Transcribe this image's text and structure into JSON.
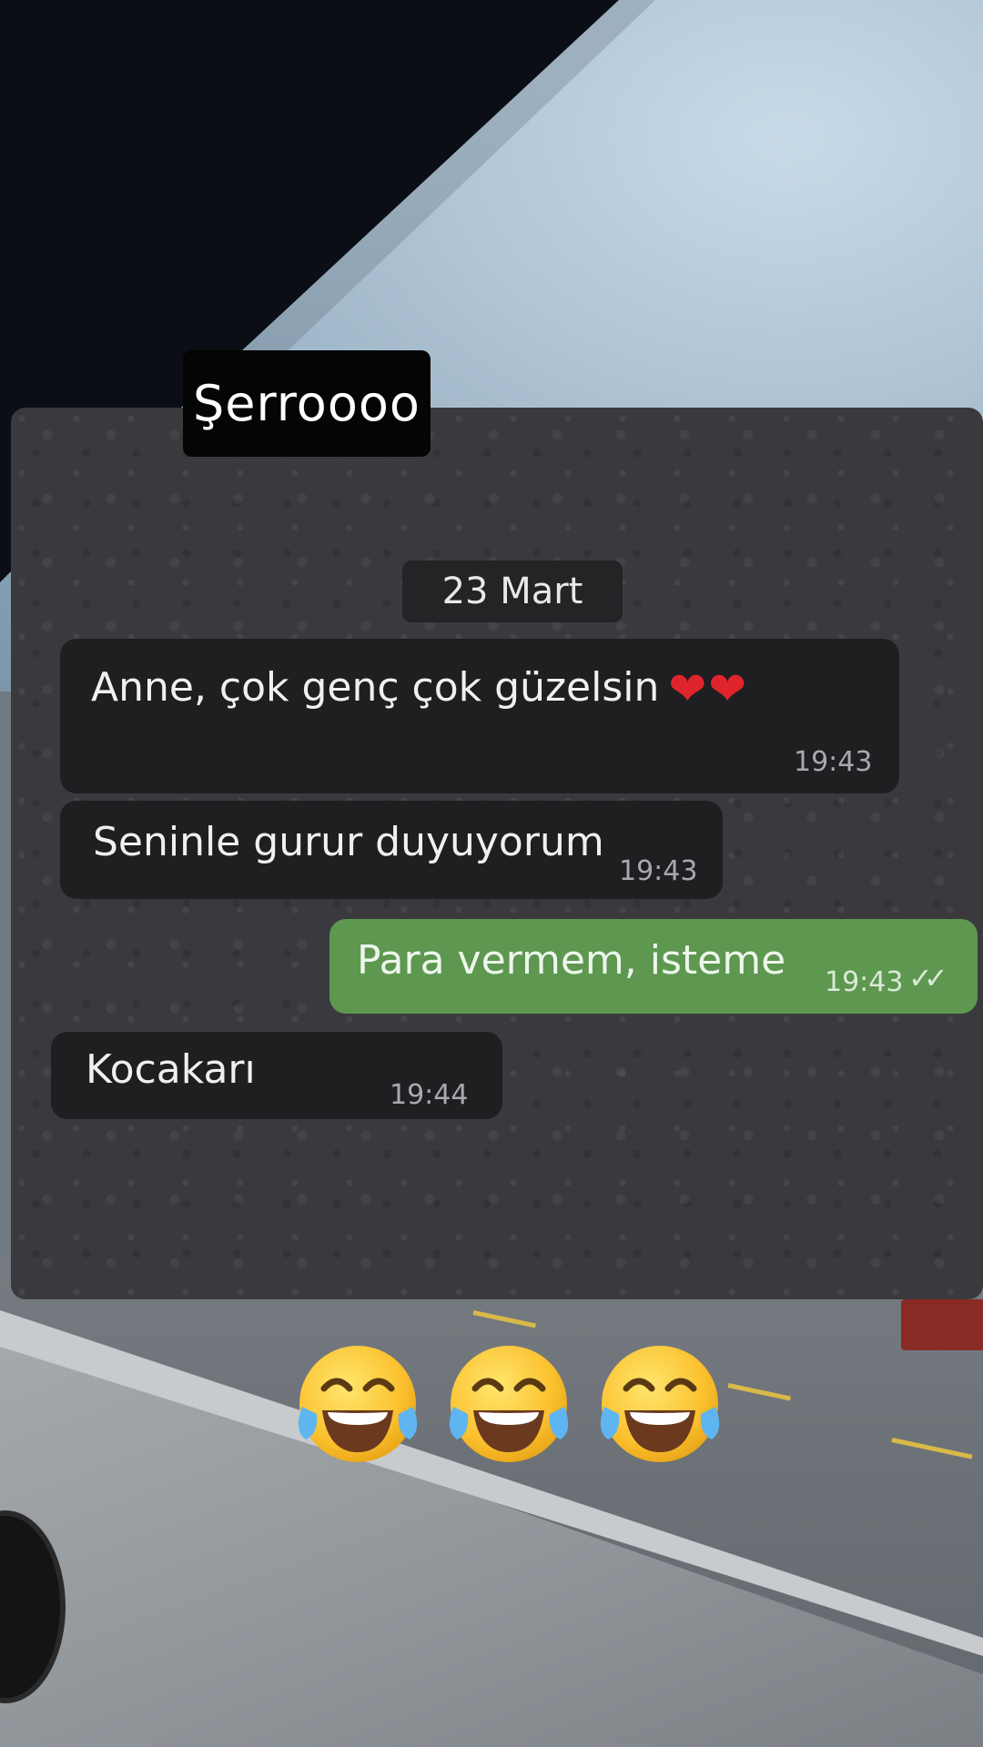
{
  "sticker": {
    "name": "Şerroooo"
  },
  "chat": {
    "date_label": "23 Mart",
    "messages": [
      {
        "direction": "incoming",
        "text": "Anne, çok genç çok güzelsin",
        "emoji": "❤❤",
        "time": "19:43"
      },
      {
        "direction": "incoming",
        "text": "Seninle gurur duyuyorum",
        "time": "19:43"
      },
      {
        "direction": "outgoing",
        "text": "Para vermem, isteme",
        "time": "19:43",
        "status": "read-double-check"
      },
      {
        "direction": "incoming",
        "text": "Kocakarı",
        "time": "19:44"
      }
    ]
  },
  "reaction": {
    "emoji": "face-with-tears-of-joy",
    "count": 3
  },
  "colors": {
    "incoming_bubble": "#1f1f22",
    "outgoing_bubble": "#5d9750",
    "heart": "#e0242c",
    "chat_background": "#3a3a3e"
  }
}
